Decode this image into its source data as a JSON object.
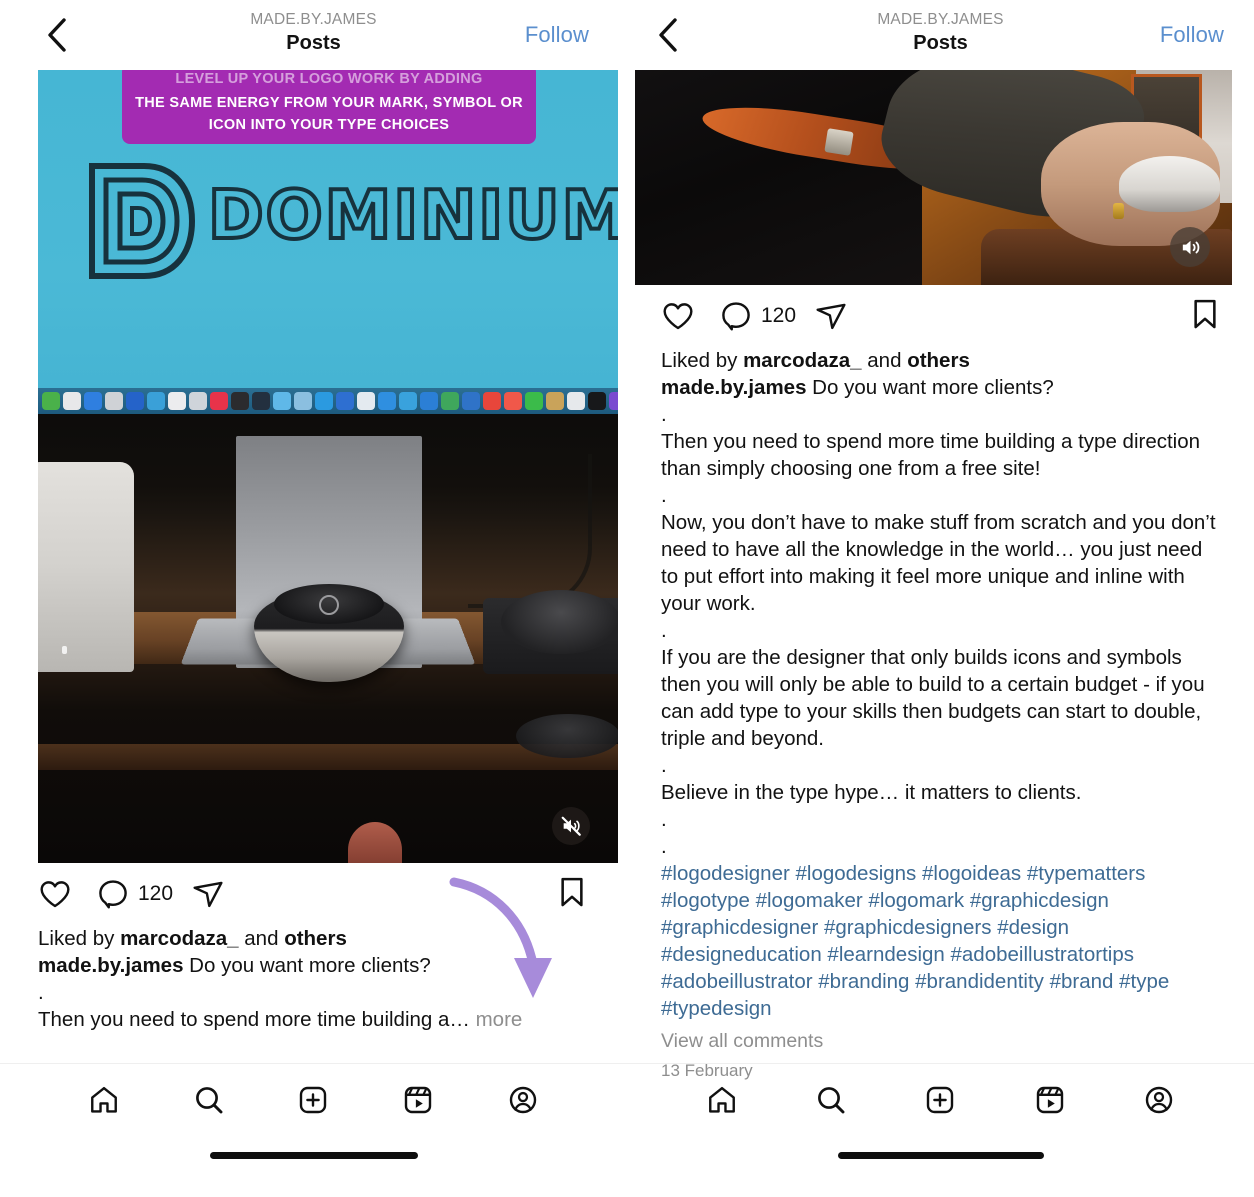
{
  "panels": [
    {
      "header": {
        "back_icon": "chevron-left-icon",
        "subtitle": "MADE.BY.JAMES",
        "title": "Posts",
        "follow_label": "Follow",
        "follow_color": "#5b8fce"
      },
      "media": {
        "type": "video-thumbnail",
        "overlay_banner_lines": [
          "LEVEL UP YOUR LOGO WORK BY ADDING",
          "THE SAME ENERGY FROM YOUR MARK, SYMBOL OR",
          "ICON INTO YOUR TYPE CHOICES"
        ],
        "banner_color": "#a32bb2",
        "background_color": "#4bb9d6",
        "logo_wordmark": "DOMINIUM",
        "audio_state_icon": "sound-muted-icon"
      },
      "actions": {
        "like_icon": "heart-icon",
        "comment_icon": "comment-bubble-icon",
        "comment_count": "120",
        "share_icon": "paper-plane-icon",
        "save_icon": "bookmark-icon"
      },
      "caption": {
        "liked_by_prefix": "Liked by ",
        "liked_by_user": "marcodaza_",
        "liked_by_middle": " and ",
        "liked_by_suffix": "others",
        "username": "made.by.james",
        "first_line": " Do you want more clients?",
        "dot": ".",
        "truncated_line": "Then you need to spend more time building a… ",
        "more_label": "more"
      },
      "annotation": {
        "type": "curved-arrow",
        "color": "#a78bda",
        "points_to": "more"
      },
      "navbar": {
        "items": [
          {
            "icon": "home-icon",
            "name": "nav-home"
          },
          {
            "icon": "search-icon",
            "name": "nav-search"
          },
          {
            "icon": "plus-square-icon",
            "name": "nav-create"
          },
          {
            "icon": "reels-icon",
            "name": "nav-reels"
          },
          {
            "icon": "profile-icon",
            "name": "nav-profile"
          }
        ]
      }
    },
    {
      "header": {
        "back_icon": "chevron-left-icon",
        "subtitle": "MADE.BY.JAMES",
        "title": "Posts",
        "follow_label": "Follow",
        "follow_color": "#5b8fce"
      },
      "media": {
        "type": "video-thumbnail",
        "description": "hand on a computer mouse at a wooden desk",
        "audio_state_icon": "sound-on-icon"
      },
      "actions": {
        "like_icon": "heart-icon",
        "comment_icon": "comment-bubble-icon",
        "comment_count": "120",
        "share_icon": "paper-plane-icon",
        "save_icon": "bookmark-icon"
      },
      "caption": {
        "liked_by_prefix": "Liked by ",
        "liked_by_user": "marcodaza_",
        "liked_by_middle": " and ",
        "liked_by_suffix": "others",
        "username": "made.by.james",
        "first_line": " Do you want more clients?",
        "paragraphs": [
          ".",
          "Then you need to spend more time building a type direction than simply choosing one from a free site!",
          ".",
          "Now, you don’t have to make stuff from scratch and you don’t need to have all the knowledge in the world… you just need to put effort into making it feel more unique and inline with your work.",
          ".",
          "If you are the designer that only builds icons and symbols then you will only be able to build to a certain budget - if you can add type to your skills then budgets can start to double, triple and beyond.",
          ".",
          "Believe in the type hype… it matters to clients.",
          ".",
          "."
        ],
        "hashtags": "#logodesigner #logodesigns #logoideas #typematters #logotype #logomaker #logomark #graphicdesign #graphicdesigner #graphicdesigners #design #designeducation #learndesign #adobeillustratortips #adobeillustrator #branding #brandidentity #brand #type #typedesign",
        "hashtag_color": "#3e6b94",
        "view_comments_label": "View all comments",
        "date": "13 February"
      },
      "navbar": {
        "items": [
          {
            "icon": "home-icon",
            "name": "nav-home"
          },
          {
            "icon": "search-icon",
            "name": "nav-search"
          },
          {
            "icon": "plus-square-icon",
            "name": "nav-create"
          },
          {
            "icon": "reels-icon",
            "name": "nav-reels"
          },
          {
            "icon": "profile-icon",
            "name": "nav-profile"
          }
        ]
      }
    }
  ]
}
